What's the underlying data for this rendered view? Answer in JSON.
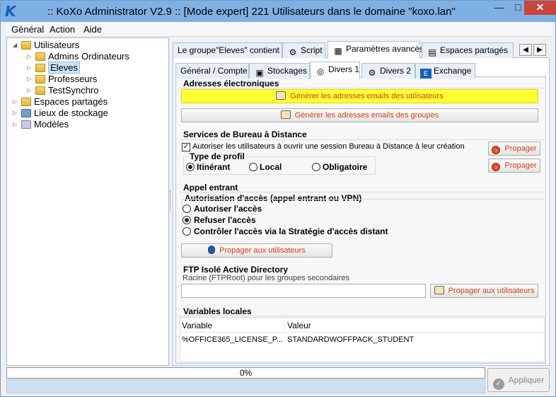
{
  "window": {
    "title": ":: KoXo Administrator V2.9 :: [Mode expert] 221 Utilisateurs dans le domaine \"koxo.lan\"",
    "controls": {
      "minimize": "—",
      "maximize": "□",
      "close": "✕"
    }
  },
  "menu": {
    "items": [
      "Général",
      "Action",
      "Aide"
    ],
    "underlined": [
      "G",
      "A",
      "A"
    ]
  },
  "tree": {
    "items": [
      {
        "label": "Utilisateurs",
        "icon": "users-folder-icon",
        "expanded": true
      },
      {
        "label": "Admins Ordinateurs",
        "icon": "folder-icon"
      },
      {
        "label": "Eleves",
        "icon": "folder-icon",
        "selected": true
      },
      {
        "label": "Professeurs",
        "icon": "folder-icon"
      },
      {
        "label": "TestSynchro",
        "icon": "folder-icon"
      },
      {
        "label": "Espaces partagés",
        "icon": "shared-space-icon"
      },
      {
        "label": "Lieux de stockage",
        "icon": "storage-icon"
      },
      {
        "label": "Modèles",
        "icon": "model-icon"
      }
    ]
  },
  "tabs": [
    {
      "label": "Le groupe\"Eleves\" contient"
    },
    {
      "label": "Script",
      "icon": "gears-icon"
    },
    {
      "label": "Paramètres avancés",
      "icon": "settings-icon",
      "active": true
    },
    {
      "label": "Espaces partagés",
      "icon": "shared-space-icon"
    }
  ],
  "subtabs": [
    {
      "label": "Général / Compte"
    },
    {
      "label": "Stockages",
      "icon": "storage-icon"
    },
    {
      "label": "Divers 1",
      "icon": "misc-icon",
      "active": true
    },
    {
      "label": "Divers 2",
      "icon": "gear-icon"
    },
    {
      "label": "Exchange",
      "icon": "exchange-icon"
    }
  ],
  "email": {
    "title": "Adresses électroniques",
    "gen_users": "Générer les adresses emails des utilisateurs",
    "gen_groups": "Générer les adresses emails des groupes"
  },
  "rds": {
    "title": "Services de Bureau à Distance",
    "allow_label": "Autoriser les utilisateurs à ouvrir une session Bureau à Distance à leur création",
    "allow_checked": true,
    "propagate": "Propager",
    "profile_title": "Type de profil",
    "profiles": [
      "Itinérant",
      "Local",
      "Obligatoire"
    ],
    "profile_selected": "Itinérant"
  },
  "dialin": {
    "title": "Appel entrant",
    "auth_title": "Autorisation d'accès (appel entrant ou VPN)",
    "options": [
      "Autoriser l'accès",
      "Refuser l'accès",
      "Contrôler l'accès via la Stratégie d'accès distant"
    ],
    "selected": "Refuser l'accès",
    "propagate": "Propager aux utilisateurs"
  },
  "ftp": {
    "title": "FTP Isolé Active Directory",
    "root_label": "Racine (FTPRoot) pour les groupes secondaires",
    "root_value": "",
    "propagate": "Propager aux utilisateurs"
  },
  "vars": {
    "title": "Variables locales",
    "col_variable": "Variable",
    "col_value": "Valeur",
    "rows": [
      {
        "variable": "%OFFICE365_LICENSE_P...",
        "value": "STANDARDWOFFPACK_STUDENT"
      }
    ]
  },
  "status": {
    "progress_text": "0%",
    "progress": 0
  },
  "apply": {
    "label": "Appliquer",
    "enabled": false
  },
  "colors": {
    "titlebar": "#7fb0e4",
    "close": "#c7463a",
    "highlight": "#ffff33",
    "action_text": "#d8401f"
  }
}
